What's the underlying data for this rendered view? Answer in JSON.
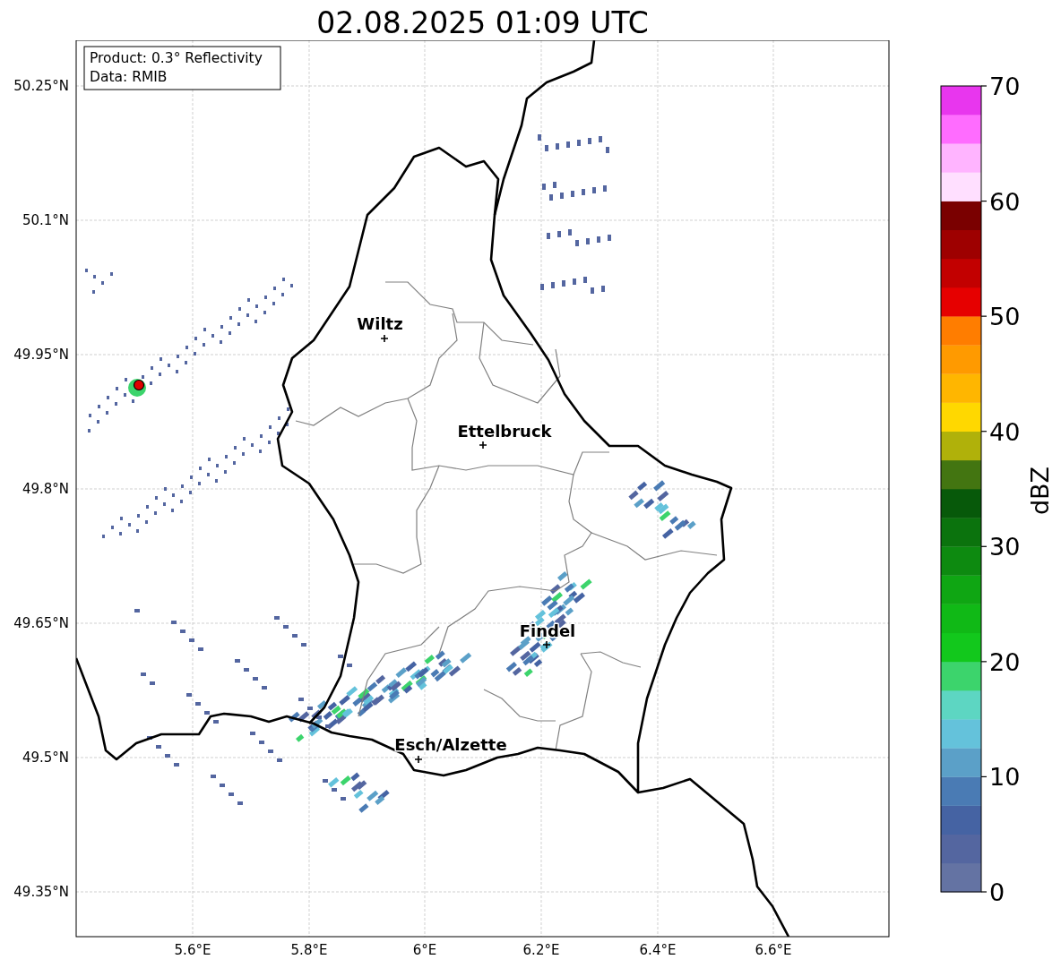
{
  "title": "02.08.2025 01:09 UTC",
  "info_box": [
    "Product: 0.3° Reflectivity",
    "Data: RMIB"
  ],
  "cities": [
    {
      "name": "Wiltz"
    },
    {
      "name": "Ettelbruck"
    },
    {
      "name": "Findel"
    },
    {
      "name": "Esch/Alzette"
    }
  ],
  "y_ticks": [
    "50.25°N",
    "50.1°N",
    "49.95°N",
    "49.8°N",
    "49.65°N",
    "49.5°N",
    "49.35°N"
  ],
  "x_ticks": [
    "5.6°E",
    "5.8°E",
    "6°E",
    "6.2°E",
    "6.4°E",
    "6.6°E"
  ],
  "colorbar": {
    "label": "dBZ",
    "ticks": [
      "70",
      "60",
      "50",
      "40",
      "30",
      "20",
      "10",
      "0"
    ],
    "bins": [
      {
        "color": "#6473a3"
      },
      {
        "color": "#5466a0"
      },
      {
        "color": "#4563a3"
      },
      {
        "color": "#4a7bb4"
      },
      {
        "color": "#5ba0c8"
      },
      {
        "color": "#64c2db"
      },
      {
        "color": "#5dd6c2"
      },
      {
        "color": "#3cd46c"
      },
      {
        "color": "#12c81c"
      },
      {
        "color": "#10b916"
      },
      {
        "color": "#0fa613"
      },
      {
        "color": "#0d8a10"
      },
      {
        "color": "#0b730d"
      },
      {
        "color": "#07590a"
      },
      {
        "color": "#437511"
      },
      {
        "color": "#b0b10a"
      },
      {
        "color": "#ffd800"
      },
      {
        "color": "#ffb600"
      },
      {
        "color": "#ff9a00"
      },
      {
        "color": "#ff7d00"
      },
      {
        "color": "#e60000"
      },
      {
        "color": "#c20000"
      },
      {
        "color": "#9e0000"
      },
      {
        "color": "#7a0000"
      },
      {
        "color": "#ffdfff"
      },
      {
        "color": "#ffb4ff"
      },
      {
        "color": "#ff6cff"
      },
      {
        "color": "#e836ee"
      }
    ]
  }
}
